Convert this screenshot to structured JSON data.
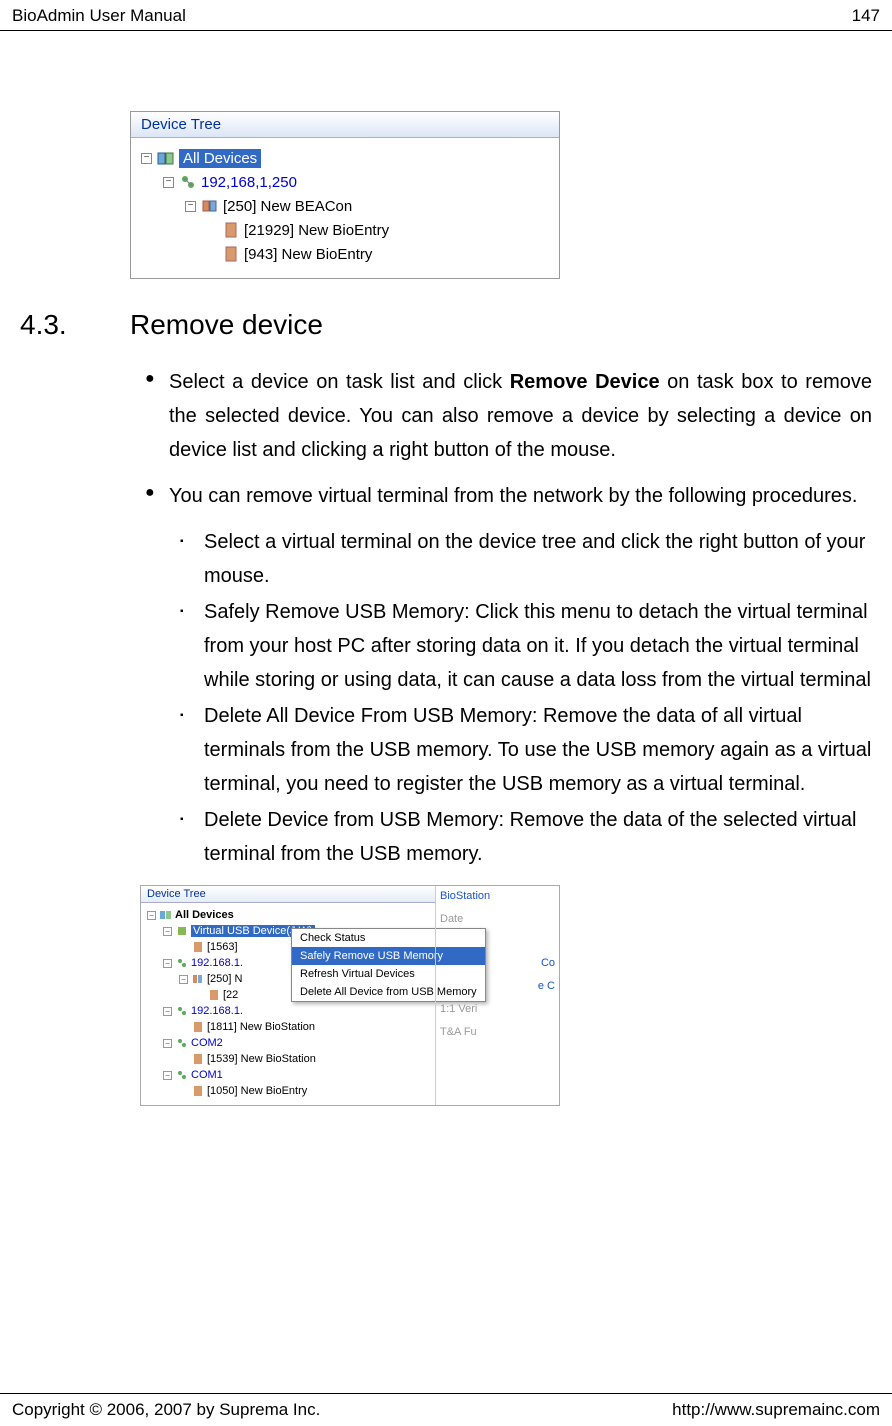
{
  "header": {
    "left": "BioAdmin User Manual",
    "right": "147"
  },
  "screenshot1": {
    "title": "Device Tree",
    "root": "All Devices",
    "ip": "192,168,1,250",
    "devices": [
      "[250] New BEACon",
      "[21929] New BioEntry",
      "[943] New BioEntry"
    ]
  },
  "section": {
    "num": "4.3.",
    "title": "Remove device"
  },
  "bullets": [
    {
      "pre": "Select a device on task list and click ",
      "bold": "Remove Device",
      "post": " on task box to remove the selected device. You can also remove a device by selecting a device on device list and clicking a right button of the mouse."
    },
    {
      "pre": "You can remove virtual terminal from the network by the following procedures.",
      "bold": "",
      "post": ""
    }
  ],
  "sub_bullets": [
    "Select a virtual terminal on the device tree and click the right button of your mouse.",
    "Safely Remove USB Memory: Click this menu to detach the virtual terminal from your host PC after storing data on it. If you detach the virtual terminal while storing or using data, it can cause a data loss from the virtual terminal",
    "Delete All Device From USB Memory: Remove the data of all virtual terminals from the USB memory. To use the USB memory again as a virtual terminal, you need to register the USB memory as a virtual terminal.",
    "Delete Device from USB Memory: Remove the data of the selected virtual terminal from the USB memory."
  ],
  "screenshot2": {
    "title": "Device Tree",
    "root": "All Devices",
    "usb_sel": "Virtual USB Device(J:₩)",
    "rows": [
      "[1563]",
      "192.168.1.",
      "[250] N",
      "[22",
      "192.168.1.",
      "[1811] New BioStation",
      "COM2",
      "[1539] New BioStation",
      "COM1",
      "[1050] New BioEntry"
    ],
    "menu": [
      "Check Status",
      "Safely Remove USB Memory",
      "Refresh Virtual Devices",
      "Delete All Device from USB Memory"
    ],
    "right": [
      "BioStation",
      "Date",
      "Co",
      "e C",
      "1:1 Veri",
      "T&A Fu"
    ]
  },
  "footer": {
    "left": "Copyright © 2006, 2007 by Suprema Inc.",
    "right": "http://www.supremainc.com"
  }
}
